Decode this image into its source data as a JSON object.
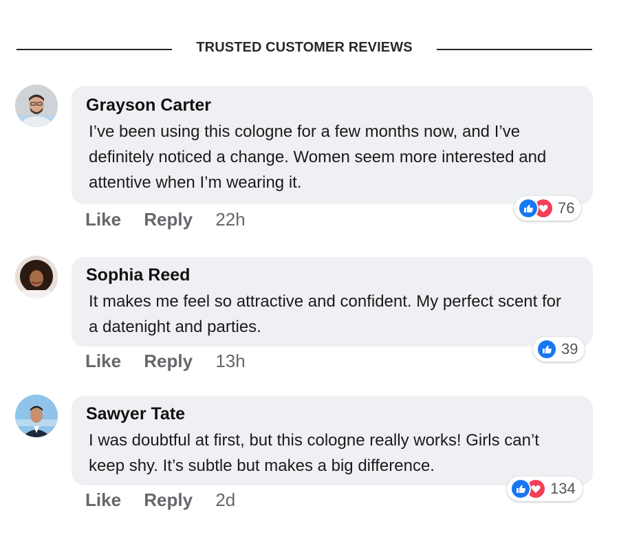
{
  "header": {
    "title": "TRUSTED CUSTOMER REVIEWS"
  },
  "reviews": [
    {
      "name": "Grayson Carter",
      "text": "I’ve been using this cologne for a few months now, and I’ve definitely noticed a change. Women seem more interested and attentive when I’m wearing it.",
      "like_label": "Like",
      "reply_label": "Reply",
      "time": "22h",
      "reactions": [
        "like-icon",
        "love-icon"
      ],
      "reaction_count": "76"
    },
    {
      "name": "Sophia Reed",
      "text": "It makes me feel so attractive and confident. My perfect scent for a datenight and parties.",
      "like_label": "Like",
      "reply_label": "Reply",
      "time": "13h",
      "reactions": [
        "like-icon"
      ],
      "reaction_count": "39"
    },
    {
      "name": "Sawyer Tate",
      "text": "I was doubtful at first, but this cologne really works! Girls can’t keep shy. It’s subtle but makes a big difference.",
      "like_label": "Like",
      "reply_label": "Reply",
      "time": "2d",
      "reactions": [
        "like-icon",
        "love-icon"
      ],
      "reaction_count": "134"
    }
  ],
  "colors": {
    "like": "#1877f2",
    "love": "#f33e58",
    "bubble": "#eff0f3",
    "action_text": "#65676b"
  }
}
